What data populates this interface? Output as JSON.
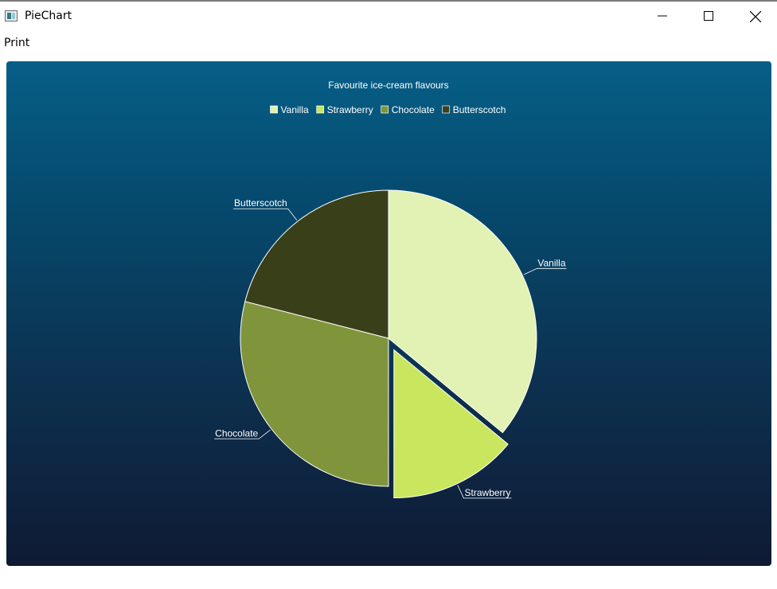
{
  "window": {
    "title": "PieChart",
    "icons": [
      "app-icon",
      "minimize-icon",
      "maximize-icon",
      "close-icon"
    ]
  },
  "menu": {
    "items": [
      "Print"
    ]
  },
  "chart_data": {
    "type": "pie",
    "title": "Favourite ice-cream flavours",
    "legend_placement": "top-center",
    "categories": [
      "Vanilla",
      "Strawberry",
      "Chocolate",
      "Butterscotch"
    ],
    "values": [
      36,
      14,
      29,
      21
    ],
    "colors": [
      "#e2f1b4",
      "#c9e65e",
      "#80943c",
      "#393f18"
    ],
    "exploded": [
      "Strawberry"
    ],
    "label_color": "#ffffff",
    "background_top": "#065f87",
    "background_bottom": "#0f1a34"
  }
}
